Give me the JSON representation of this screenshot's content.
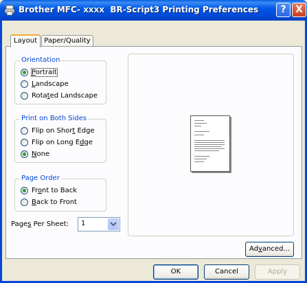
{
  "window": {
    "title_app": "Brother MFC- ",
    "title_model": "XXXX",
    "title_rest": "  BR-Script3 Printing Preferences",
    "help_symbol": "?",
    "close_symbol": "X",
    "icon": "printer-icon"
  },
  "tabs": [
    {
      "label": "Layout",
      "active": true
    },
    {
      "label": "Paper/Quality",
      "active": false
    }
  ],
  "orientation": {
    "legend": "Orientation",
    "options": [
      {
        "pre": "",
        "key": "P",
        "post": "ortrait",
        "selected": true
      },
      {
        "pre": "",
        "key": "L",
        "post": "andscape",
        "selected": false
      },
      {
        "pre": "Rota",
        "key": "t",
        "post": "ed Landscape",
        "selected": false
      }
    ]
  },
  "both_sides": {
    "legend": "Print on Both Sides",
    "options": [
      {
        "pre": "Flip on Shor",
        "key": "t",
        "post": " Edge",
        "selected": false
      },
      {
        "pre": "Flip on Long E",
        "key": "d",
        "post": "ge",
        "selected": false
      },
      {
        "pre": "",
        "key": "N",
        "post": "one",
        "selected": true
      }
    ]
  },
  "page_order": {
    "legend": "Page Order",
    "options": [
      {
        "pre": "Fr",
        "key": "o",
        "post": "nt to Back",
        "selected": true
      },
      {
        "pre": "",
        "key": "B",
        "post": "ack to Front",
        "selected": false
      }
    ]
  },
  "pages_per_sheet": {
    "label_pre": "Page",
    "label_key": "s",
    "label_post": " Per Sheet:",
    "value": "1"
  },
  "buttons": {
    "advanced_pre": "Ad",
    "advanced_key": "v",
    "advanced_post": "anced...",
    "ok": "OK",
    "cancel": "Cancel",
    "apply": "Apply"
  },
  "colors": {
    "titlebar": "#0058E6",
    "dialog_bg": "#ECE9D8",
    "legend_text": "#0046D5",
    "radio_dot": "#21A121",
    "active_tab_highlight": "#F1AB3C"
  }
}
